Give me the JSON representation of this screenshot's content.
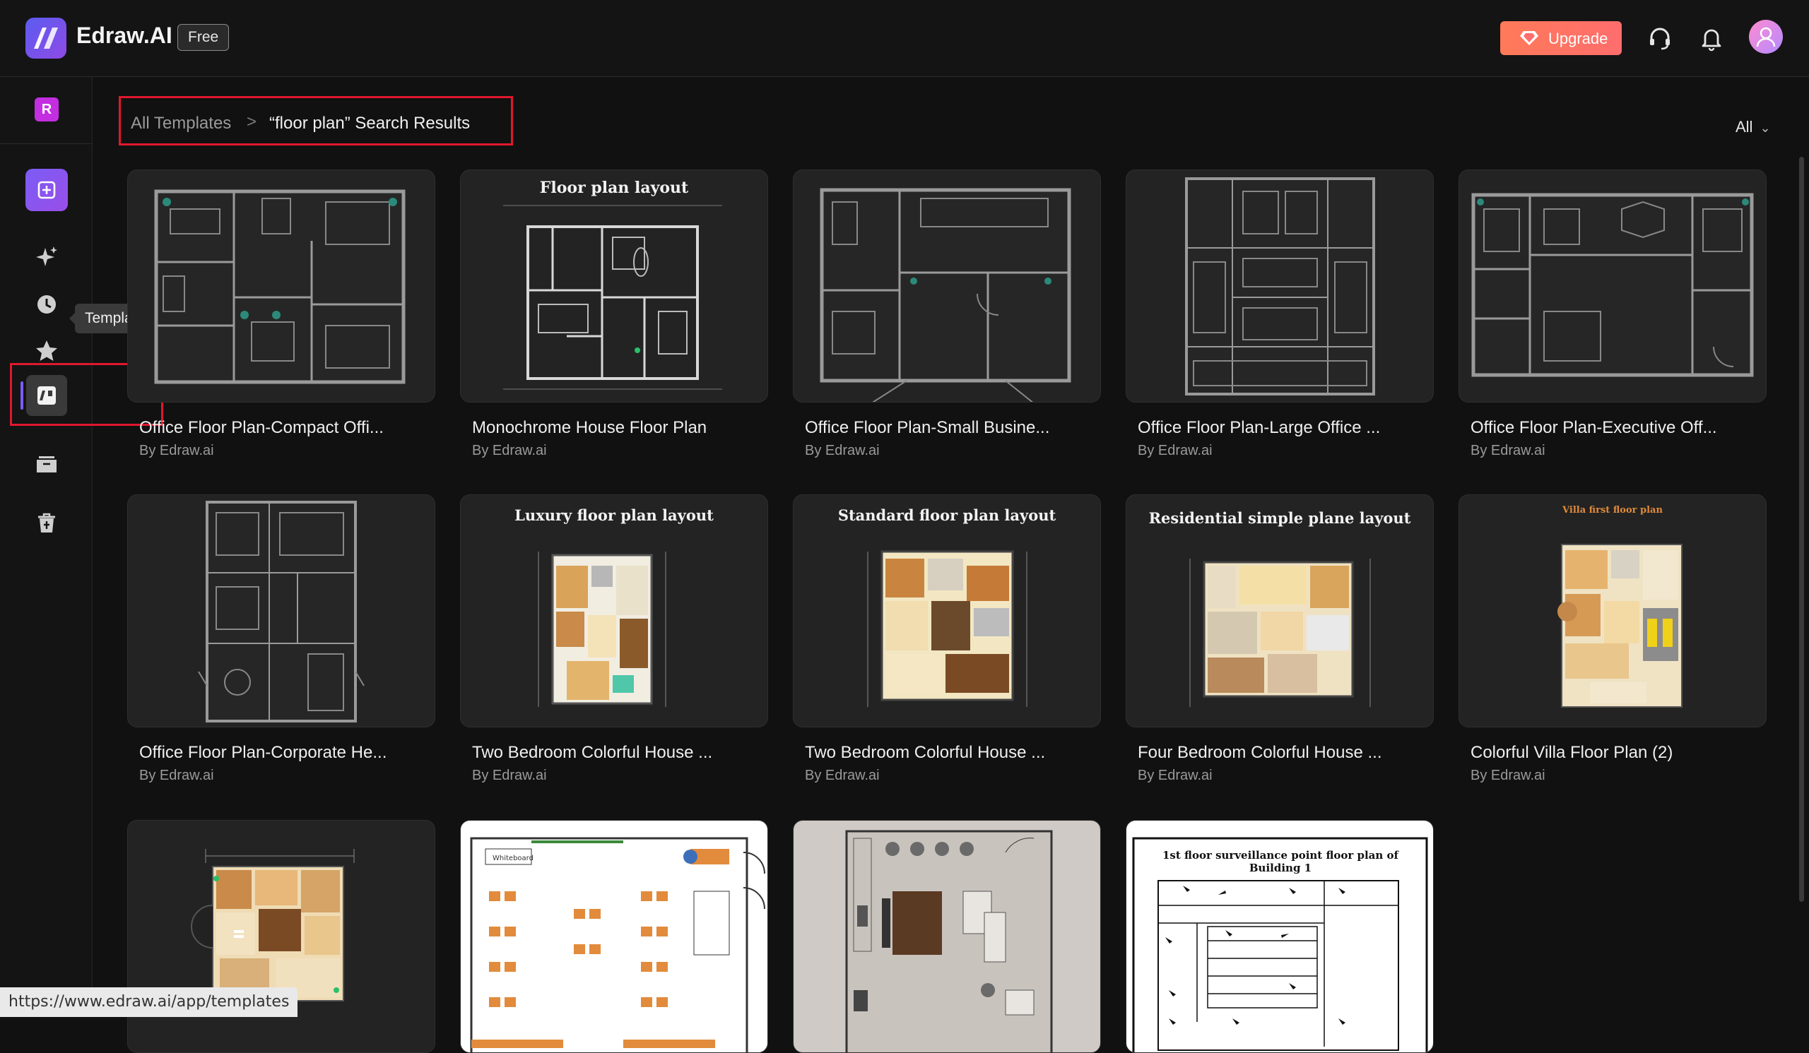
{
  "header": {
    "app_name": "Edraw.AI",
    "plan_badge": "Free",
    "upgrade_label": "Upgrade",
    "icons": [
      "support-headset-icon",
      "notification-bell-icon",
      "user-avatar-icon"
    ]
  },
  "sidebar": {
    "workspace_initial": "R",
    "items": [
      {
        "name": "new-document",
        "icon": "plus-square-icon"
      },
      {
        "name": "ai",
        "icon": "sparkle-icon"
      },
      {
        "name": "recent",
        "icon": "clock-icon"
      },
      {
        "name": "favorites",
        "icon": "star-icon"
      },
      {
        "name": "templates",
        "icon": "templates-icon",
        "active": true
      },
      {
        "name": "files",
        "icon": "folder-icon"
      },
      {
        "name": "trash",
        "icon": "trash-icon"
      }
    ],
    "tooltip": "Templates"
  },
  "breadcrumb": {
    "root": "All Templates",
    "separator": ">",
    "current": "“floor plan” Search Results"
  },
  "filter": {
    "selected": "All"
  },
  "cards": [
    {
      "title": "Office Floor Plan-Compact Offi...",
      "author": "By Edraw.ai",
      "heading": ""
    },
    {
      "title": "Monochrome House Floor Plan",
      "author": "By Edraw.ai",
      "heading": "Floor plan layout"
    },
    {
      "title": "Office Floor Plan-Small Busine...",
      "author": "By Edraw.ai",
      "heading": ""
    },
    {
      "title": "Office Floor Plan-Large Office ...",
      "author": "By Edraw.ai",
      "heading": ""
    },
    {
      "title": "Office Floor Plan-Executive Off...",
      "author": "By Edraw.ai",
      "heading": ""
    },
    {
      "title": "Office Floor Plan-Corporate He...",
      "author": "By Edraw.ai",
      "heading": ""
    },
    {
      "title": "Two Bedroom Colorful House ...",
      "author": "By Edraw.ai",
      "heading": "Luxury floor plan layout"
    },
    {
      "title": "Two Bedroom Colorful House ...",
      "author": "By Edraw.ai",
      "heading": "Standard floor plan layout"
    },
    {
      "title": "Four Bedroom Colorful House ...",
      "author": "By Edraw.ai",
      "heading": "Residential simple plane layout"
    },
    {
      "title": "Colorful Villa Floor Plan (2)",
      "author": "By Edraw.ai",
      "heading": "Villa first floor plan"
    },
    {
      "title": "",
      "author": "",
      "heading": ""
    },
    {
      "title": "",
      "author": "",
      "heading": "Whiteboard"
    },
    {
      "title": "",
      "author": "",
      "heading": ""
    },
    {
      "title": "",
      "author": "",
      "heading": "1st floor surveillance point floor plan of Building 1"
    }
  ],
  "status_url": "https://www.edraw.ai/app/templates",
  "colors": {
    "accent": "#7b5cf5",
    "upgrade": "#ff7a59",
    "highlight_box": "#e0182d",
    "background": "#111111"
  }
}
